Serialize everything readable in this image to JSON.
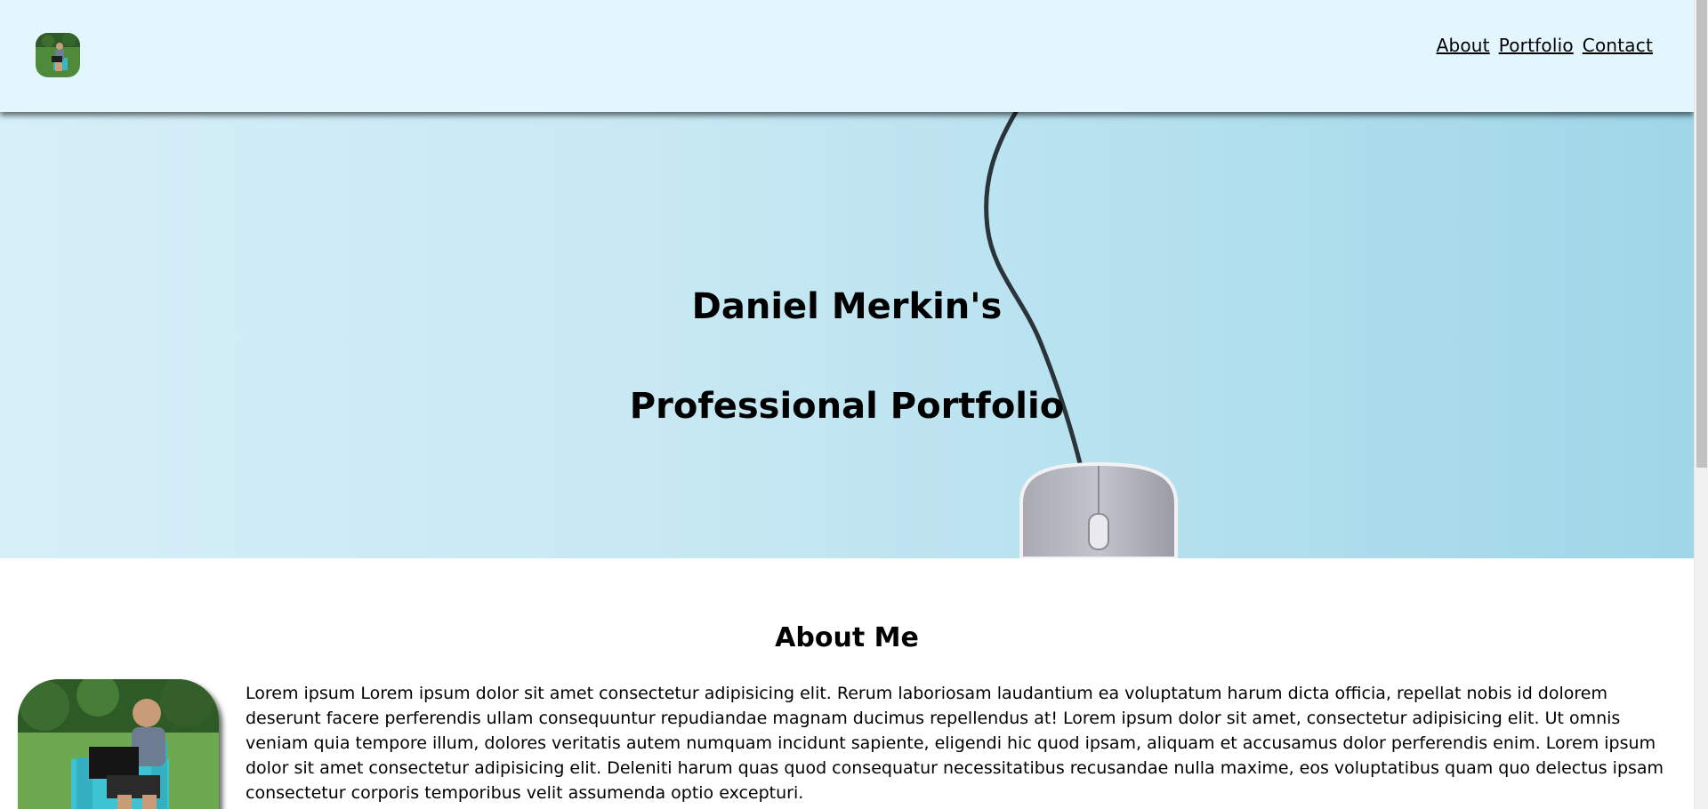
{
  "header": {
    "logo_alt": "profile photo",
    "nav": [
      {
        "label": "About"
      },
      {
        "label": "Portfolio"
      },
      {
        "label": "Contact"
      }
    ]
  },
  "hero": {
    "title_line1": "Daniel Merkin's",
    "title_line2": "Professional Portfolio",
    "background_image": "computer-mouse-on-light-blue-desk"
  },
  "about": {
    "heading": "About Me",
    "photo_alt": "man sitting in blue adirondack chair with laptop",
    "text": "Lorem ipsum Lorem ipsum dolor sit amet consectetur adipisicing elit. Rerum laboriosam laudantium ea voluptatum harum dicta officia, repellat nobis id dolorem deserunt facere perferendis ullam consequuntur repudiandae magnam ducimus repellendus at! Lorem ipsum dolor sit amet, consectetur adipisicing elit. Ut omnis veniam quia tempore illum, dolores veritatis autem numquam incidunt sapiente, eligendi hic quod ipsam, aliquam et accusamus dolor perferendis enim. Lorem ipsum dolor sit amet consectetur adipisicing elit. Deleniti harum quas quod consequatur necessitatibus recusandae nulla maxime, eos voluptatibus quam quo delectus ipsam consectetur corporis temporibus velit assumenda optio excepturi."
  },
  "colors": {
    "header_bg": "#e3f6fd",
    "hero_bg": "#c7e8f3",
    "text": "#000000"
  }
}
